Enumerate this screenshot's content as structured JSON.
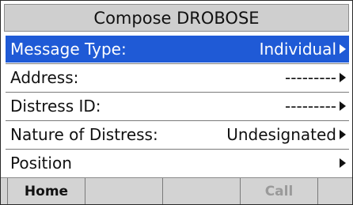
{
  "title": "Compose DROBOSE",
  "menu": [
    {
      "label": "Message Type:",
      "value": "Individual",
      "selected": true
    },
    {
      "label": "Address:",
      "value": "---------"
    },
    {
      "label": "Distress ID:",
      "value": "---------"
    },
    {
      "label": "Nature of Distress:",
      "value": "Undesignated"
    },
    {
      "label": "Position",
      "value": ""
    }
  ],
  "softkeys": {
    "home": "Home",
    "key2": "",
    "key3": "",
    "call": "Call"
  },
  "colors": {
    "selection": "#1f5ad6",
    "title_bar": "#cfcfcf",
    "softkey_bar": "#d3d3d3",
    "disabled_text": "#9a9a9a"
  },
  "icons": {
    "row_arrow": "right-triangle-icon"
  }
}
